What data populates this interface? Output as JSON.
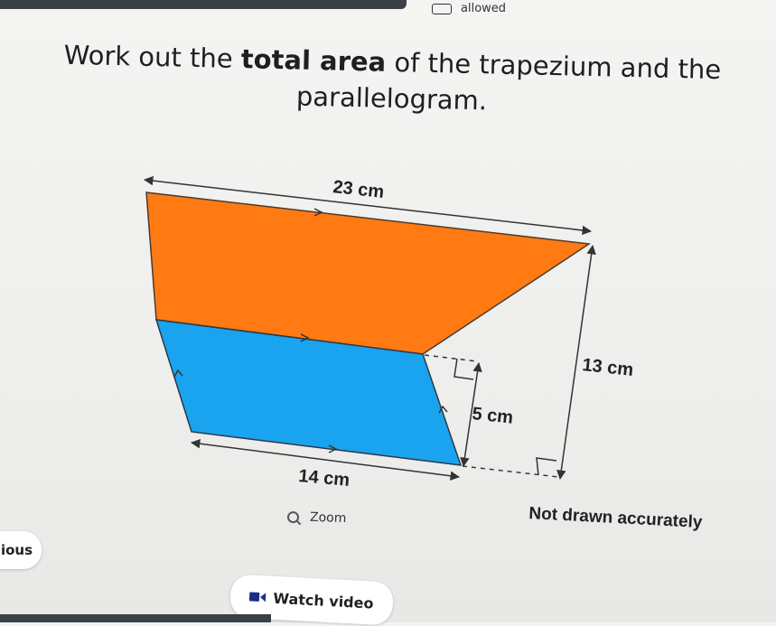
{
  "header": {
    "allowed_label": "allowed",
    "calculator_icon": "calculator-icon"
  },
  "question": {
    "text_before": "Work out the ",
    "text_bold": "total area",
    "text_after": " of the trapezium and the parallelogram."
  },
  "diagram": {
    "labels": {
      "top": "23 cm",
      "bottom": "14 cm",
      "height_total": "13 cm",
      "height_parallelogram": "5 cm"
    },
    "colors": {
      "trapezium": "#ff7a12",
      "parallelogram": "#1aa3ee"
    }
  },
  "controls": {
    "zoom_label": "Zoom",
    "zoom_icon": "magnifier-icon",
    "not_drawn_note": "Not drawn accurately",
    "previous_label": "ious",
    "watch_video_label": "Watch video",
    "video_icon": "video-camera-icon"
  }
}
